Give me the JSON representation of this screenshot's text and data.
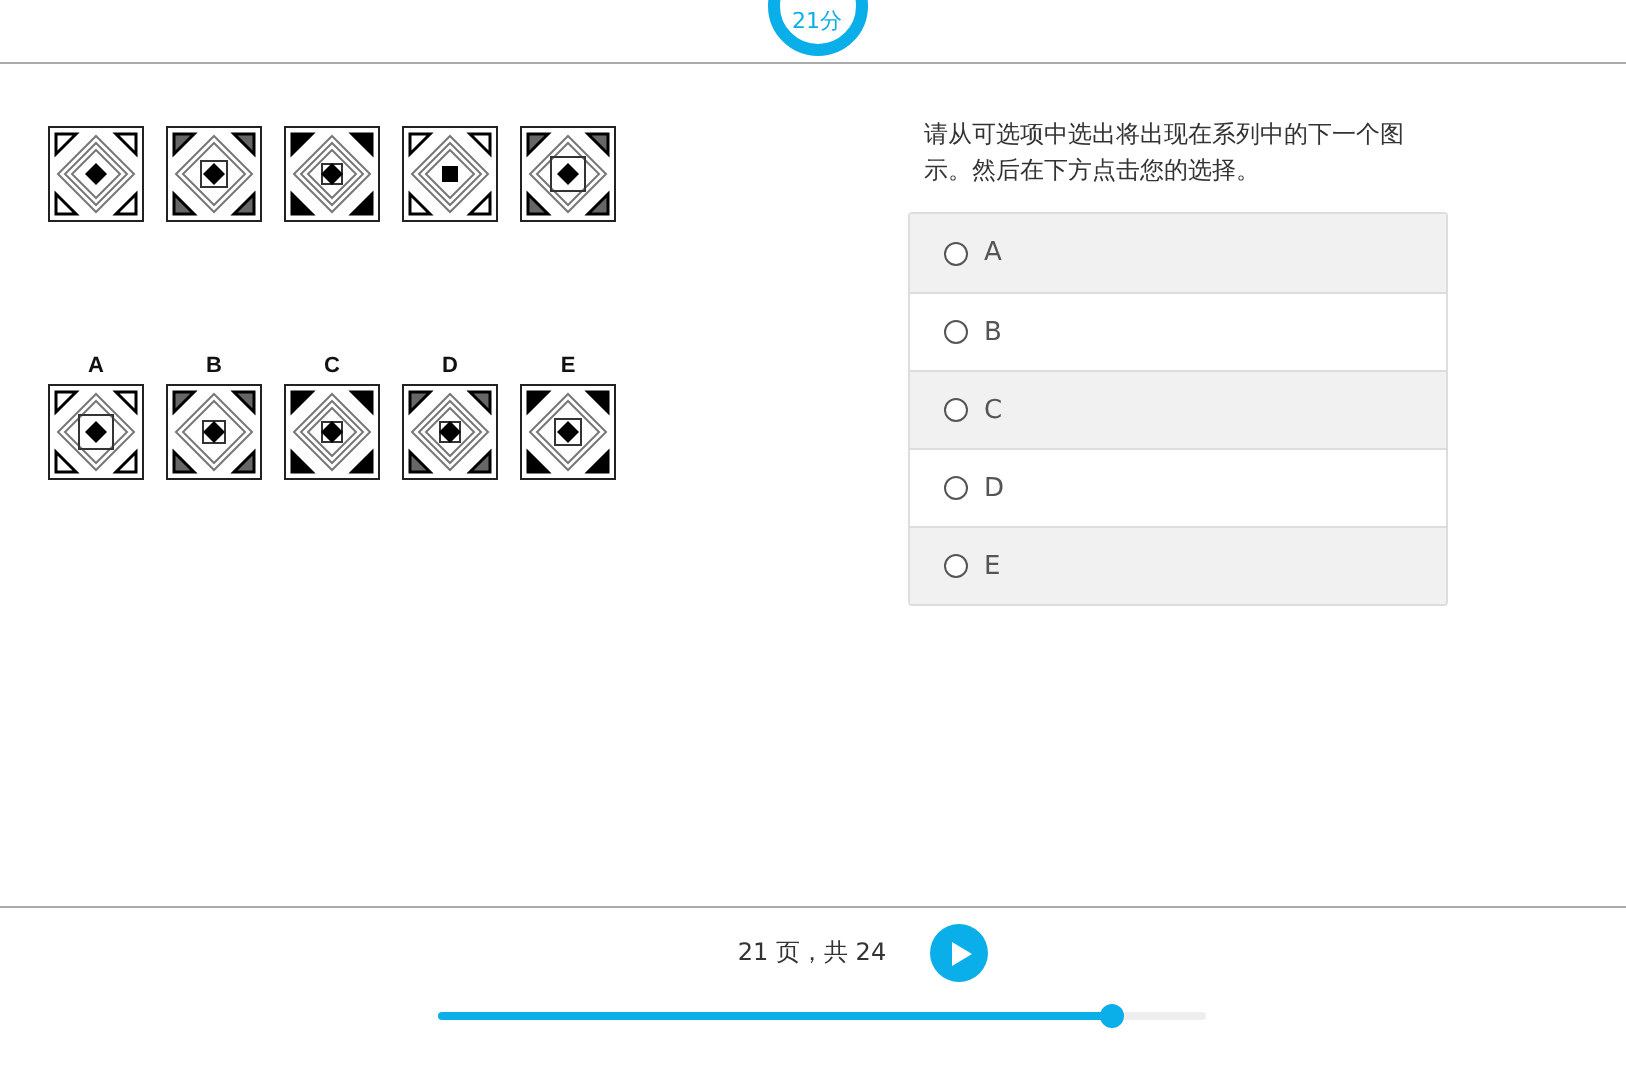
{
  "timer": {
    "label": "21分"
  },
  "question": {
    "text": "请从可选项中选出将出现在系列中的下一个图示。然后在下方点击您的选择。"
  },
  "answer_labels": [
    "A",
    "B",
    "C",
    "D",
    "E"
  ],
  "options": [
    {
      "label": "A",
      "selected": false
    },
    {
      "label": "B",
      "selected": false
    },
    {
      "label": "C",
      "selected": false
    },
    {
      "label": "D",
      "selected": false
    },
    {
      "label": "E",
      "selected": false
    }
  ],
  "footer": {
    "page_text": "21 页，共 24",
    "progress": {
      "level": 0.88
    }
  }
}
